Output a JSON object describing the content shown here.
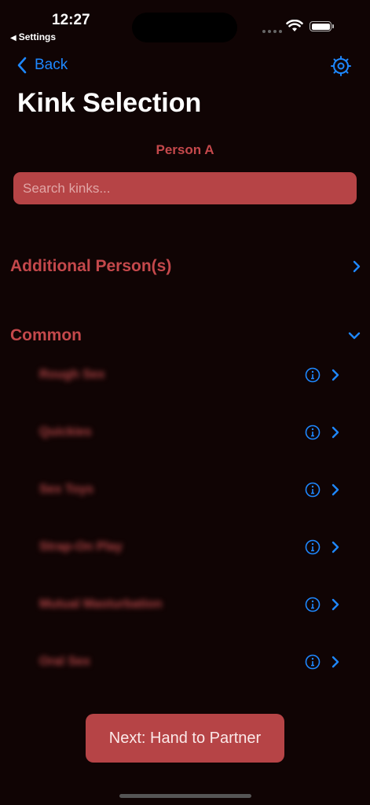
{
  "status_bar": {
    "time": "12:27",
    "back_app": "Settings",
    "back_glyph": "◀"
  },
  "nav": {
    "back_label": "Back",
    "settings_icon": "gear-icon"
  },
  "title": "Kink Selection",
  "person_label": "Person A",
  "search": {
    "placeholder": "Search kinks...",
    "value": ""
  },
  "sections": {
    "additional": {
      "label": "Additional Person(s)",
      "expanded": false
    },
    "common": {
      "label": "Common",
      "expanded": true,
      "items": [
        {
          "label": "Rough Sex"
        },
        {
          "label": "Quickies"
        },
        {
          "label": "Sex Toys"
        },
        {
          "label": "Strap-On Play"
        },
        {
          "label": "Mutual Masturbation"
        },
        {
          "label": "Oral Sex"
        }
      ]
    }
  },
  "next_button": "Next: Hand to Partner",
  "colors": {
    "background": "#100404",
    "accent_red": "#c4484b",
    "field_red": "#b64446",
    "link_blue": "#1e88ff"
  }
}
